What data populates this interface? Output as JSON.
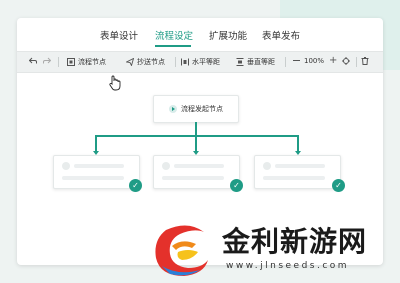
{
  "tabs": [
    {
      "label": "表单设计"
    },
    {
      "label": "流程设定"
    },
    {
      "label": "扩展功能"
    },
    {
      "label": "表单发布"
    }
  ],
  "toolbar": {
    "undo_icon": "undo-icon",
    "redo_icon": "redo-icon",
    "flow_node": "流程节点",
    "cc_node": "抄送节点",
    "h_spacing": "水平等距",
    "v_spacing": "垂直等距",
    "zoom": "100%",
    "zoom_out_icon": "minus-icon",
    "zoom_in_icon": "plus-icon",
    "locate_icon": "target-icon",
    "delete_icon": "trash-icon"
  },
  "flow": {
    "start_node": "流程发起节点",
    "children_count": 3
  },
  "watermark": {
    "title": "金利新游网",
    "url": "www.jlnseeds.com"
  },
  "colors": {
    "accent": "#1f9c86",
    "toolbar_bg": "#eef1f1",
    "page_bg": "#eef3f2"
  }
}
